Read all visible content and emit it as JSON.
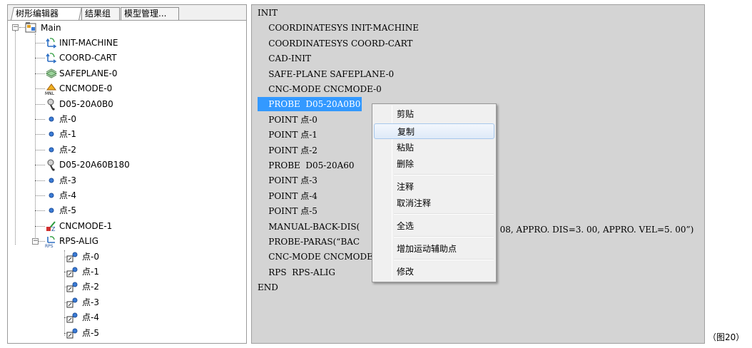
{
  "tabs": [
    "树形编辑器",
    "结果组",
    "模型管理..."
  ],
  "tree": {
    "root": "Main",
    "root_expander": "−",
    "items": [
      {
        "label": "INIT-MACHINE",
        "icon": "coordinate-axes-icon"
      },
      {
        "label": "COORD-CART",
        "icon": "coordinate-axes-icon"
      },
      {
        "label": "SAFEPLANE-0",
        "icon": "safe-plane-icon"
      },
      {
        "label": "CNCMODE-0",
        "icon": "cnc-manual-mode-icon",
        "icon_text": "MNL"
      },
      {
        "label": "D05-20A0B0",
        "icon": "probe-icon"
      },
      {
        "label": "点-0",
        "icon": "point-icon"
      },
      {
        "label": "点-1",
        "icon": "point-icon"
      },
      {
        "label": "点-2",
        "icon": "point-icon"
      },
      {
        "label": "D05-20A60B180",
        "icon": "probe-icon"
      },
      {
        "label": "点-3",
        "icon": "point-icon"
      },
      {
        "label": "点-4",
        "icon": "point-icon"
      },
      {
        "label": "点-5",
        "icon": "point-icon"
      },
      {
        "label": "CNCMODE-1",
        "icon": "cnc-mode-icon"
      },
      {
        "label": "RPS-ALIG",
        "icon": "rps-align-icon",
        "icon_text": "RPS",
        "expander": "−"
      }
    ],
    "rps_children": [
      "点-0",
      "点-1",
      "点-2",
      "点-3",
      "点-4",
      "点-5"
    ]
  },
  "editor": {
    "lines": [
      "INIT",
      "    COORDINATESYS INIT-MACHINE",
      "    COORDINATESYS COORD-CART",
      "    CAD-INIT",
      "    SAFE-PLANE SAFEPLANE-0",
      "    CNC-MODE CNCMODE-0",
      "    PROBE  D05-20A0B0",
      "    POINT 点-0",
      "    POINT 点-1",
      "    POINT 点-2",
      "    PROBE  D05-20A60",
      "    POINT 点-3",
      "    POINT 点-4",
      "    POINT 点-5",
      "    MANUAL-BACK-DIS(",
      "    PROBE-PARAS(“BAC",
      "    CNC-MODE CNCMODE",
      "    RPS  RPS-ALIG",
      "END"
    ],
    "selected_line": 6,
    "probe_paras_tail": ". 08, APPRO. DIS=3. 00, APPRO. VEL=5. 00”)"
  },
  "context_menu": {
    "items": [
      "剪贴",
      "复制",
      "粘贴",
      "删除",
      "注释",
      "取消注释",
      "全选",
      "增加运动辅助点",
      "修改"
    ],
    "hover_index": 1
  },
  "caption": "（图20）",
  "colors": {
    "selection": "#3399ff",
    "editor_bg": "#d4d4d4",
    "menu_bg": "#f0f0f0"
  }
}
